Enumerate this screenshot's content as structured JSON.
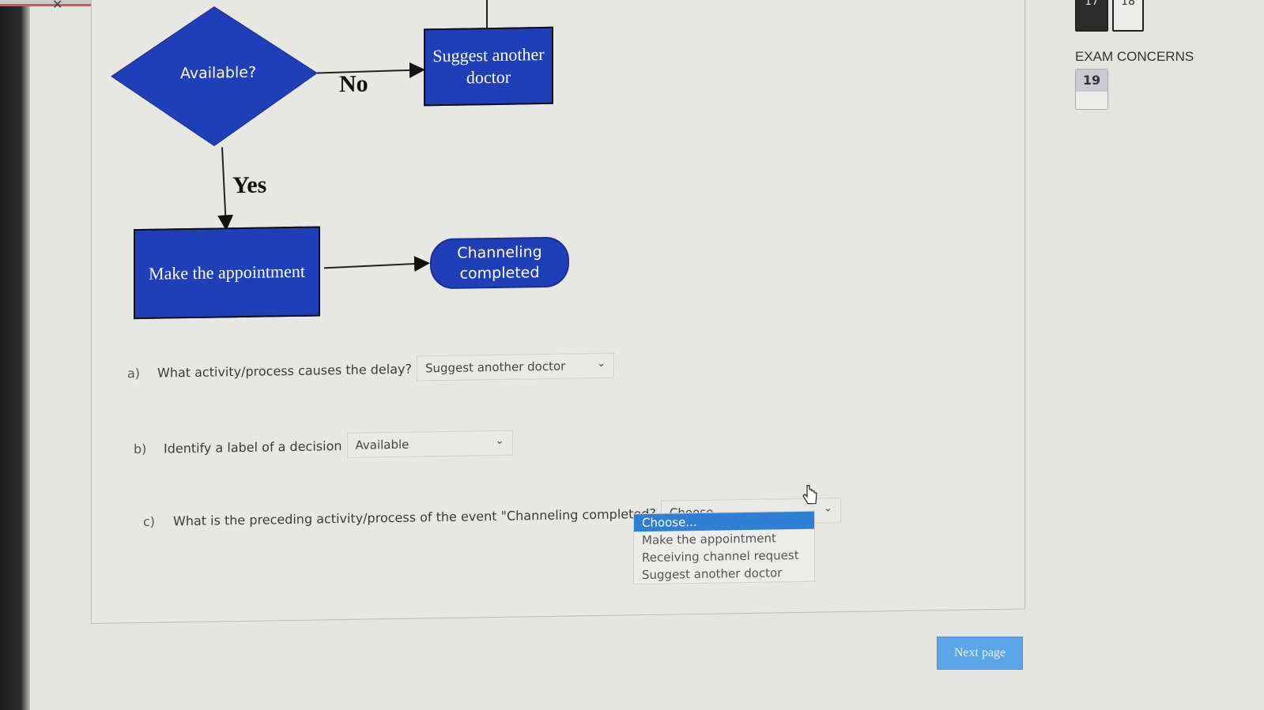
{
  "flowchart": {
    "decision": "Available?",
    "no_label": "No",
    "yes_label": "Yes",
    "box_suggest": "Suggest another doctor",
    "box_make": "Make the appointment",
    "terminal": "Channeling completed",
    "colors": {
      "shape_fill": "#1f3fb8",
      "stroke": "#111111"
    }
  },
  "questions": [
    {
      "letter": "a)",
      "text": "What activity/process causes the delay?",
      "selected": "Suggest another doctor"
    },
    {
      "letter": "b)",
      "text": "Identify  a label of a decision",
      "selected": "Available"
    },
    {
      "letter": "c)",
      "text": "What is the preceding activity/process of the event \"Channeling completed?",
      "selected": "Choose..."
    }
  ],
  "dropdown": {
    "options": [
      "Choose...",
      "Make the appointment",
      "Receiving channel request",
      "Suggest another doctor"
    ],
    "highlighted_index": 0,
    "highlight_color": "#2f7fd4"
  },
  "next_button": "Next page",
  "quiz_nav": {
    "question_numbers": [
      "17",
      "18"
    ],
    "section": "EXAM CONCERNS",
    "section_question": "19"
  }
}
